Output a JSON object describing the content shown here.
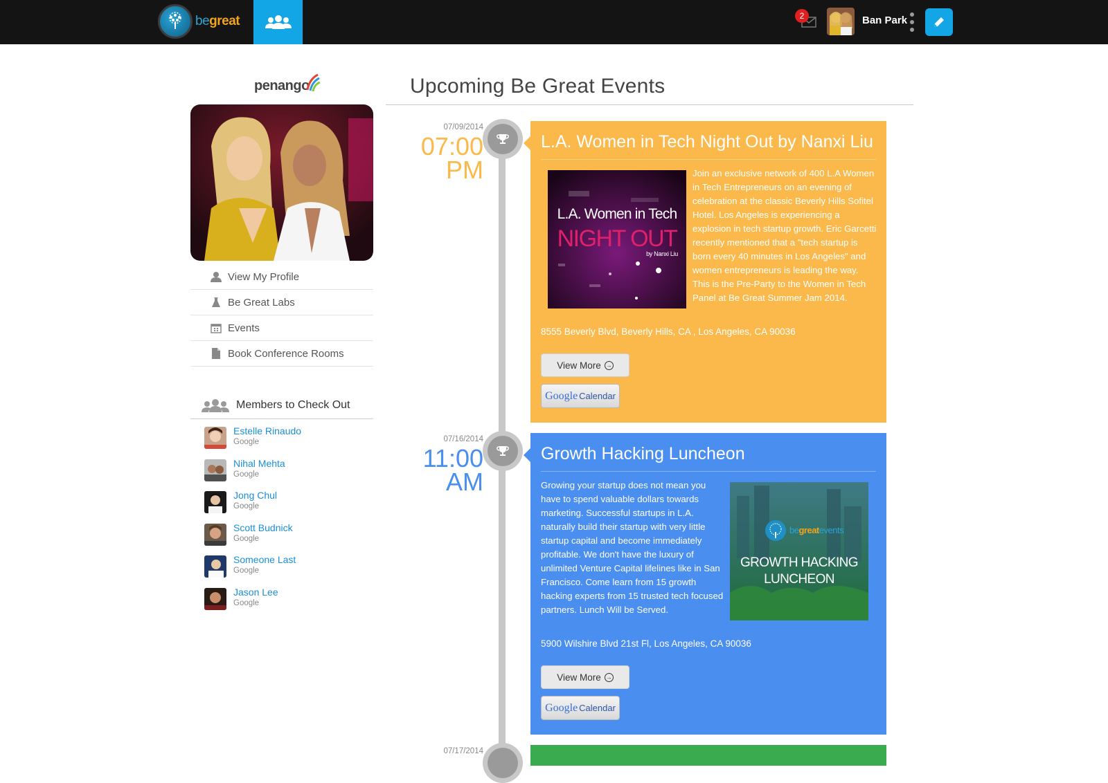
{
  "topbar": {
    "logo_be": "be",
    "logo_great": "great",
    "mail_badge": "2",
    "user_name": "Ban Park"
  },
  "sidebar": {
    "company_logo": "penango",
    "menu": [
      {
        "label": "View My Profile",
        "icon": "user-icon"
      },
      {
        "label": "Be Great Labs",
        "icon": "flask-icon"
      },
      {
        "label": "Events",
        "icon": "calendar-icon"
      },
      {
        "label": "Book Conference Rooms",
        "icon": "document-icon"
      }
    ],
    "members_title": "Members to Check Out",
    "members": [
      {
        "name": "Estelle Rinaudo",
        "company": "Google"
      },
      {
        "name": "Nihal Mehta",
        "company": "Google"
      },
      {
        "name": "Jong Chul",
        "company": "Google"
      },
      {
        "name": "Scott Budnick",
        "company": "Google"
      },
      {
        "name": "Someone Last",
        "company": "Google"
      },
      {
        "name": "Jason Lee",
        "company": "Google"
      }
    ]
  },
  "main": {
    "title": "Upcoming Be Great Events",
    "events": [
      {
        "date": "07/09/2014",
        "time_hm": "07:00",
        "time_ampm": "PM",
        "title": "L.A. Women in Tech Night Out by Nanxi Liu",
        "image_line1": "L.A. Women in Tech",
        "image_line2": "NIGHT OUT",
        "image_line3": "by Nanxi Liu",
        "description": "Join an exclusive network of 400 L.A Women in Tech Entrepreneurs on an evening of celebration at the classic Beverly Hills Sofitel Hotel. Los Angeles is experiencing a explosion in tech startup growth. Eric Garcetti recently mentioned that a \"tech startup is born every 40 minutes in Los Angeles\" and women entrepreneurs is leading the way. This is the Pre-Party to the Women in Tech Panel at Be Great Summer Jam 2014.",
        "address": "8555 Beverly Blvd, Beverly Hills, CA , Los Angeles, CA 90036",
        "view_more": "View More",
        "gcal_google": "Google",
        "gcal_calendar": "Calendar",
        "color": "#fcb94b",
        "time_color": "#fcb94b"
      },
      {
        "date": "07/16/2014",
        "time_hm": "11:00",
        "time_ampm": "AM",
        "title": "Growth Hacking Luncheon",
        "image_brand_be": "be",
        "image_brand_great": "great",
        "image_brand_events": "events",
        "image_line1": "GROWTH HACKING",
        "image_line2": "LUNCHEON",
        "description": "Growing your startup does not mean you have to spend valuable dollars towards marketing. Successful startups in L.A. naturally build their startup with very little startup capital and become immediately profitable. We don't have the luxury of unlimited Venture Capital lifelines like in San Francisco. Come learn from 15 growth hacking experts from 15 trusted tech focused partners. Lunch Will be Served.",
        "address": "5900 Wilshire Blvd 21st Fl, Los Angeles, CA 90036",
        "view_more": "View More",
        "gcal_google": "Google",
        "gcal_calendar": "Calendar",
        "color": "#4a8ef0",
        "time_color": "#4a8ef0"
      },
      {
        "date": "07/17/2014",
        "color": "#3aac4f"
      }
    ]
  }
}
